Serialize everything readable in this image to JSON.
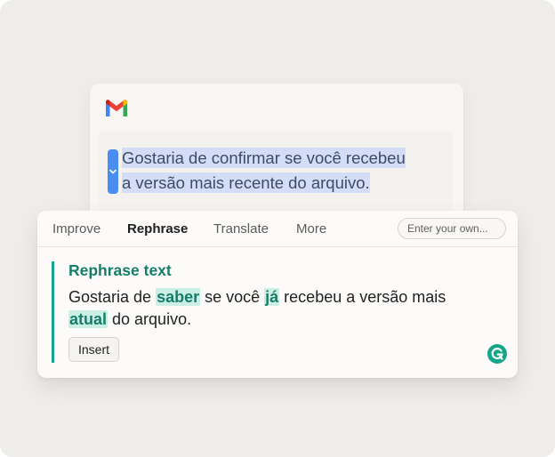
{
  "email": {
    "logo": "gmail-icon",
    "selected_lines": [
      "Gostaria de confirmar se você recebeu",
      "a versão mais recente do arquivo."
    ]
  },
  "popup": {
    "tabs": [
      {
        "label": "Improve",
        "active": false
      },
      {
        "label": "Rephrase",
        "active": true
      },
      {
        "label": "Translate",
        "active": false
      },
      {
        "label": "More",
        "active": false
      }
    ],
    "custom_prompt_placeholder": "Enter your own...",
    "suggestion": {
      "title": "Rephrase text",
      "segments": [
        {
          "text": "Gostaria de ",
          "highlight": false
        },
        {
          "text": "saber",
          "highlight": true
        },
        {
          "text": " se você ",
          "highlight": false
        },
        {
          "text": "já",
          "highlight": true
        },
        {
          "text": " recebeu a versão mais ",
          "highlight": false
        },
        {
          "text": "atual",
          "highlight": true
        },
        {
          "text": " do arquivo.",
          "highlight": false
        }
      ]
    },
    "insert_label": "Insert",
    "brand_icon": "grammarly-icon"
  },
  "colors": {
    "accent_green": "#14a68a",
    "title_green": "#167d68",
    "highlight_bg": "#cbeee5",
    "selection_bg": "#d4ddf6",
    "cursor_blue": "#4a8df0"
  }
}
